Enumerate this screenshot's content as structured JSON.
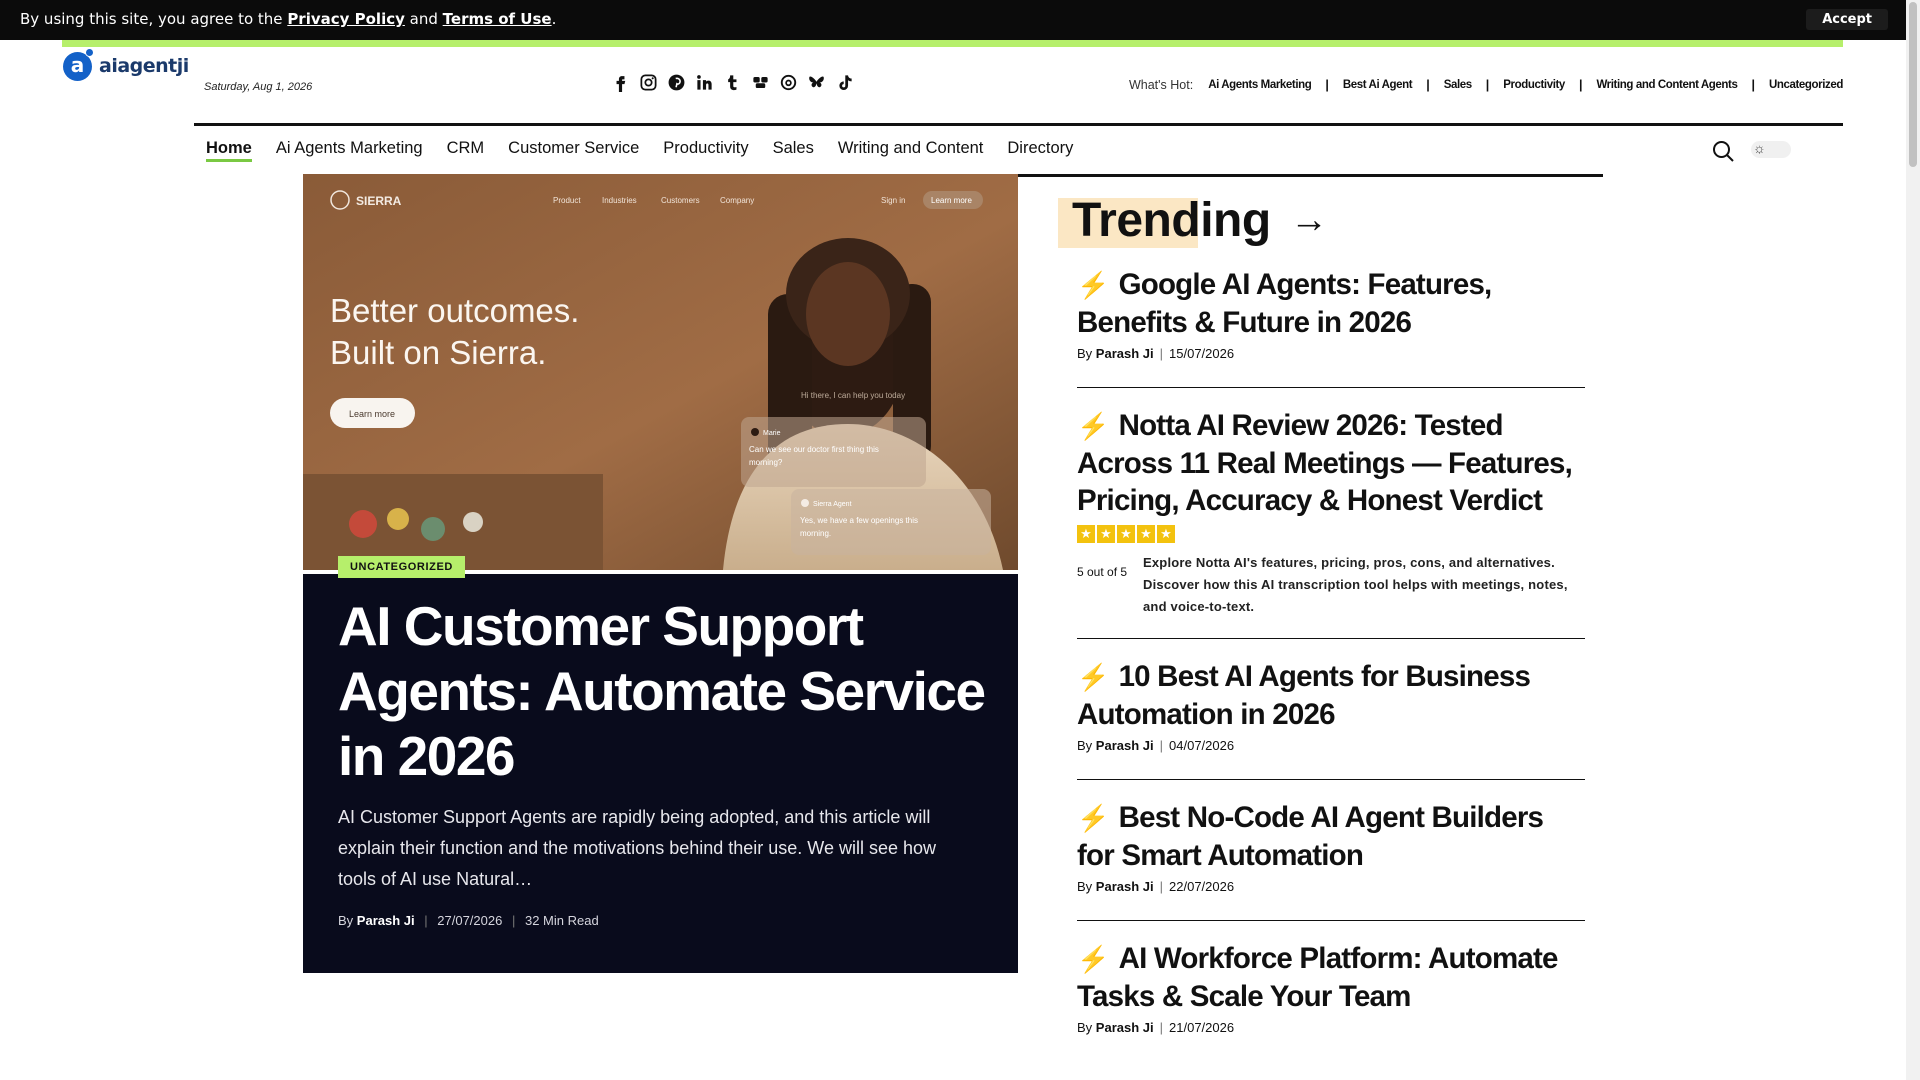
{
  "cookie": {
    "text_before": "By using this site, you agree to the ",
    "privacy_link": "Privacy Policy",
    "text_middle": " and ",
    "terms_link": "Terms of Use",
    "text_after": ".",
    "accept_label": "Accept"
  },
  "header": {
    "logo_text": "aiagentji",
    "date": "Saturday, Aug 1, 2026",
    "social_icons": [
      "facebook-icon",
      "instagram-icon",
      "pinterest-icon",
      "linkedin-icon",
      "tumblr-icon",
      "bluesky-icon",
      "threads-icon",
      "butterfly-icon",
      "tiktok-icon"
    ],
    "whats_hot_label": "What's Hot:",
    "whats_hot_items": [
      "Ai Agents Marketing",
      "Best Ai Agent",
      "Sales",
      "Productivity",
      "Writing and Content Agents",
      "Uncategorized"
    ]
  },
  "nav": {
    "items": [
      "Home",
      "Ai Agents Marketing",
      "CRM",
      "Customer Service",
      "Productivity",
      "Sales",
      "Writing and Content",
      "Directory"
    ],
    "active": "Home"
  },
  "featured": {
    "image": {
      "brand": "SIERRA",
      "nav": [
        "Product",
        "Industries",
        "Customers",
        "Company"
      ],
      "sign_in": "Sign in",
      "learn_more_top": "Learn more",
      "headline_1": "Better outcomes.",
      "headline_2": "Built on Sierra.",
      "cta": "Learn more",
      "chat_greeting": "Hi there, I can help you today",
      "chat_user": "Marie",
      "chat_user_msg": "Can we see our doctor first thing this morning?",
      "chat_agent": "Sierra Agent",
      "chat_agent_msg": "Yes, we have a few openings this morning."
    },
    "category": "UNCATEGORIZED",
    "title": "AI Customer Support Agents: Automate Service in 2026",
    "excerpt": "AI Customer Support Agents are rapidly being adopted, and this article will explain their function and the motivations behind their use. We will see how tools of AI use Natural…",
    "by": "By",
    "author": "Parash Ji",
    "date": "27/07/2026",
    "read_time": "32 Min Read"
  },
  "trending": {
    "heading": "Trending",
    "arrow": "→",
    "items": [
      {
        "title": "Google AI Agents: Features, Benefits & Future in 2026",
        "by": "By",
        "author": "Parash Ji",
        "date": "15/07/2026"
      },
      {
        "title": "Notta AI Review 2026: Tested Across 11 Real Meetings — Features, Pricing, Accuracy & Honest Verdict",
        "rating_value": 5,
        "rating_text": "5 out of 5",
        "review_desc": "Explore Notta AI's features, pricing, pros, cons, and alternatives. Discover how this AI transcription tool helps with meetings, notes, and voice-to-text."
      },
      {
        "title": "10 Best AI Agents for Business Automation in 2026",
        "by": "By",
        "author": "Parash Ji",
        "date": "04/07/2026"
      },
      {
        "title": "Best No-Code AI Agent Builders for Smart Automation",
        "by": "By",
        "author": "Parash Ji",
        "date": "22/07/2026"
      },
      {
        "title": "AI Workforce Platform: Automate Tasks & Scale Your Team",
        "by": "By",
        "author": "Parash Ji",
        "date": "21/07/2026"
      }
    ]
  },
  "colors": {
    "accent_green": "#b6ef6b",
    "dark_card": "#090b1c",
    "trend_highlight": "#fbe7c4",
    "star": "#f3c20f",
    "logo_blue": "#1361c8"
  }
}
